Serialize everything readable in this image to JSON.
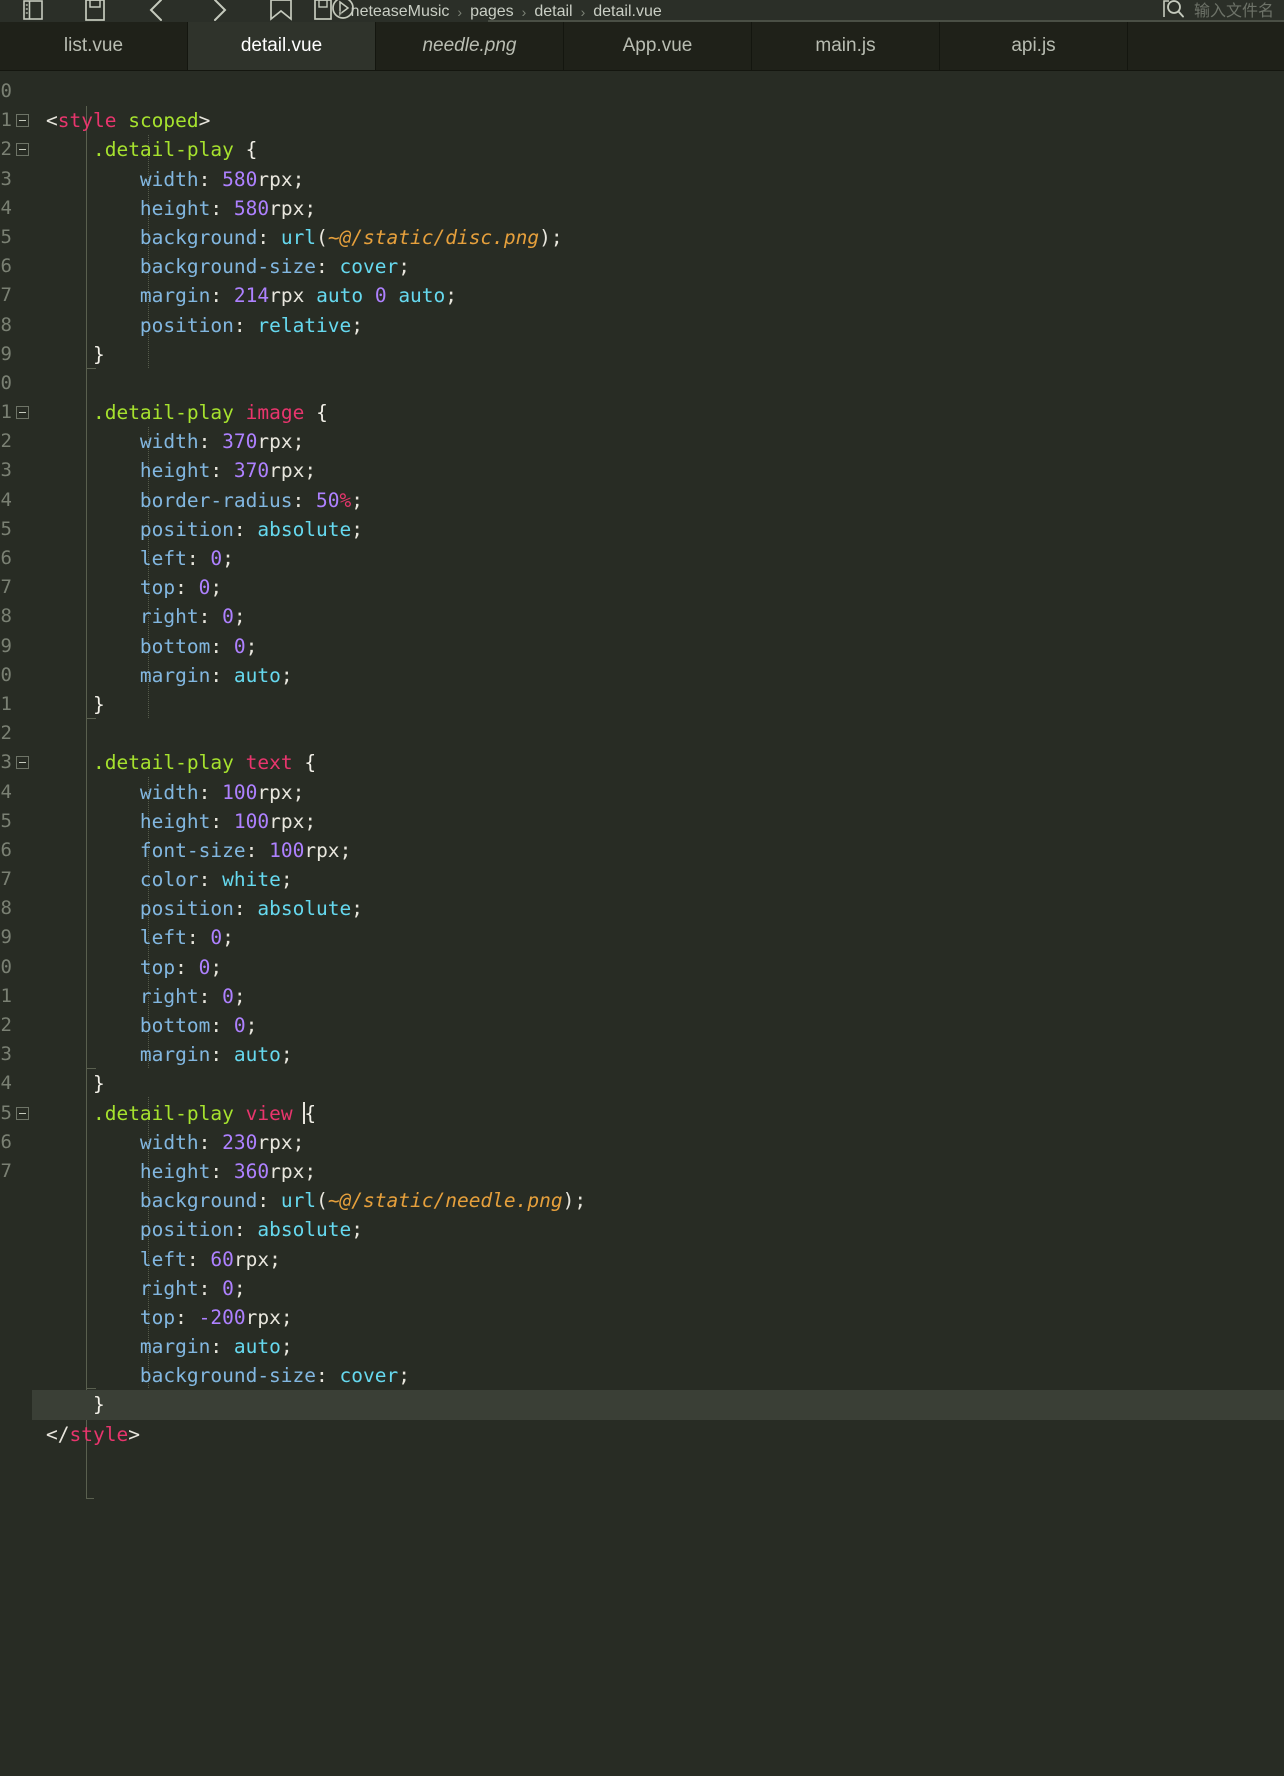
{
  "window": {
    "app": "HBuilderX",
    "theme_bg": "#282c24",
    "accent": "#a6e22e"
  },
  "toolbar": {
    "icons": [
      {
        "name": "sidebar-toggle-icon",
        "glyph": "sidebar"
      },
      {
        "name": "save-icon",
        "glyph": "floppy"
      },
      {
        "name": "back-icon",
        "glyph": "chevron-left"
      },
      {
        "name": "forward-icon",
        "glyph": "chevron-right"
      },
      {
        "name": "bookmark-icon",
        "glyph": "bookmark"
      },
      {
        "name": "run-icon",
        "glyph": "play-circle"
      }
    ],
    "breadcrumb": {
      "file_icon": "vue-file-icon",
      "items": [
        "neteaseMusic",
        "pages",
        "detail",
        "detail.vue"
      ],
      "separator": "›"
    },
    "search": {
      "icon": "search-icon",
      "placeholder": "输入文件名"
    }
  },
  "tabs": [
    {
      "label": "list.vue",
      "active": false,
      "italic": false
    },
    {
      "label": "detail.vue",
      "active": true,
      "italic": false
    },
    {
      "label": "needle.png",
      "active": false,
      "italic": true
    },
    {
      "label": "App.vue",
      "active": false,
      "italic": false
    },
    {
      "label": "main.js",
      "active": false,
      "italic": false
    },
    {
      "label": "api.js",
      "active": false,
      "italic": false
    }
  ],
  "editor": {
    "language": "vue",
    "current_line_index": 34,
    "cursor_line_index": 24,
    "line_numbers": [
      "0",
      "1",
      "2",
      "3",
      "4",
      "5",
      "6",
      "7",
      "8",
      "9",
      "0",
      "1",
      "2",
      "3",
      "4",
      "5",
      "6",
      "7",
      "8",
      "9",
      "0",
      "1",
      "2",
      "3",
      "4",
      "5",
      "6",
      "7",
      "8",
      "9",
      "0",
      "1",
      "2",
      "3",
      "4",
      "5",
      "6",
      "7"
    ],
    "fold_rows": [
      1,
      2,
      11,
      23,
      25
    ],
    "lines": [
      {
        "i": 0,
        "text": ""
      },
      {
        "i": 1,
        "text": "<style scoped>"
      },
      {
        "i": 2,
        "text": "    .detail-play {"
      },
      {
        "i": 3,
        "text": "        width: 580rpx;"
      },
      {
        "i": 4,
        "text": "        height: 580rpx;"
      },
      {
        "i": 5,
        "text": "        background: url(~@/static/disc.png);"
      },
      {
        "i": 6,
        "text": "        background-size: cover;"
      },
      {
        "i": 7,
        "text": "        margin: 214rpx auto 0 auto;"
      },
      {
        "i": 8,
        "text": "        position: relative;"
      },
      {
        "i": 9,
        "text": "    }"
      },
      {
        "i": 10,
        "text": ""
      },
      {
        "i": 11,
        "text": "    .detail-play image {"
      },
      {
        "i": 12,
        "text": "        width: 370rpx;"
      },
      {
        "i": 13,
        "text": "        height: 370rpx;"
      },
      {
        "i": 14,
        "text": "        border-radius: 50%;"
      },
      {
        "i": 15,
        "text": "        position: absolute;"
      },
      {
        "i": 16,
        "text": "        left: 0;"
      },
      {
        "i": 17,
        "text": "        top: 0;"
      },
      {
        "i": 18,
        "text": "        right: 0;"
      },
      {
        "i": 19,
        "text": "        bottom: 0;"
      },
      {
        "i": 20,
        "text": "        margin: auto;"
      },
      {
        "i": 21,
        "text": "    }"
      },
      {
        "i": 22,
        "text": ""
      },
      {
        "i": 23,
        "text": "    .detail-play text {"
      },
      {
        "i": 24,
        "text": "        width: 100rpx;"
      },
      {
        "i": 25,
        "text": "        height: 100rpx;"
      },
      {
        "i": 26,
        "text": "        font-size: 100rpx;"
      },
      {
        "i": 27,
        "text": "        color: white;"
      },
      {
        "i": 28,
        "text": "        position: absolute;"
      },
      {
        "i": 29,
        "text": "        left: 0;"
      },
      {
        "i": 30,
        "text": "        top: 0;"
      },
      {
        "i": 31,
        "text": "        right: 0;"
      },
      {
        "i": 32,
        "text": "        bottom: 0;"
      },
      {
        "i": 33,
        "text": "        margin: auto;"
      },
      {
        "i": 34,
        "text": "    }"
      },
      {
        "i": 35,
        "text": "    .detail-play view {"
      },
      {
        "i": 36,
        "text": "        width: 230rpx;"
      },
      {
        "i": 37,
        "text": "        height: 360rpx;"
      },
      {
        "i": 38,
        "text": "        background: url(~@/static/needle.png);"
      },
      {
        "i": 39,
        "text": "        position: absolute;"
      },
      {
        "i": 40,
        "text": "        left: 60rpx;"
      },
      {
        "i": 41,
        "text": "        right: 0;"
      },
      {
        "i": 42,
        "text": "        top: -200rpx;"
      },
      {
        "i": 43,
        "text": "        margin: auto;"
      },
      {
        "i": 44,
        "text": "        background-size: cover;"
      },
      {
        "i": 45,
        "text": "    }"
      },
      {
        "i": 46,
        "text": "</style>"
      },
      {
        "i": 47,
        "text": ""
      }
    ],
    "code_tokens": {
      "l1": [
        [
          "s-punct",
          "<"
        ],
        [
          "s-tag",
          "style"
        ],
        [
          "s-punct",
          " "
        ],
        [
          "s-attr",
          "scoped"
        ],
        [
          "s-punct",
          ">"
        ]
      ],
      "l2": [
        [
          "s-sel",
          "    .detail-play"
        ],
        [
          "s-punct",
          " "
        ],
        [
          "s-brace",
          "{"
        ]
      ],
      "l3": [
        [
          "s-prop",
          "        width"
        ],
        [
          "s-punct",
          ": "
        ],
        [
          "s-num",
          "580"
        ],
        [
          "s-unit",
          "rpx"
        ],
        [
          "s-punct",
          ";"
        ]
      ],
      "l4": [
        [
          "s-prop",
          "        height"
        ],
        [
          "s-punct",
          ": "
        ],
        [
          "s-num",
          "580"
        ],
        [
          "s-unit",
          "rpx"
        ],
        [
          "s-punct",
          ";"
        ]
      ],
      "l5": [
        [
          "s-prop",
          "        background"
        ],
        [
          "s-punct",
          ": "
        ],
        [
          "s-func",
          "url"
        ],
        [
          "s-punct",
          "("
        ],
        [
          "s-str",
          "~@/static/disc.png"
        ],
        [
          "s-punct",
          ");"
        ]
      ],
      "l6": [
        [
          "s-prop",
          "        background-size"
        ],
        [
          "s-punct",
          ": "
        ],
        [
          "s-value",
          "cover"
        ],
        [
          "s-punct",
          ";"
        ]
      ],
      "l7": [
        [
          "s-prop",
          "        margin"
        ],
        [
          "s-punct",
          ": "
        ],
        [
          "s-num",
          "214"
        ],
        [
          "s-unit",
          "rpx "
        ],
        [
          "s-value",
          "auto"
        ],
        [
          "s-punct",
          " "
        ],
        [
          "s-num",
          "0"
        ],
        [
          "s-punct",
          " "
        ],
        [
          "s-value",
          "auto"
        ],
        [
          "s-punct",
          ";"
        ]
      ],
      "l8": [
        [
          "s-prop",
          "        position"
        ],
        [
          "s-punct",
          ": "
        ],
        [
          "s-value",
          "relative"
        ],
        [
          "s-punct",
          ";"
        ]
      ],
      "l9": [
        [
          "s-brace",
          "    }"
        ]
      ],
      "l11": [
        [
          "s-sel",
          "    .detail-play"
        ],
        [
          "s-punct",
          " "
        ],
        [
          "s-elem",
          "image"
        ],
        [
          "s-punct",
          " "
        ],
        [
          "s-brace",
          "{"
        ]
      ],
      "l14": [
        [
          "s-prop",
          "        border-radius"
        ],
        [
          "s-punct",
          ": "
        ],
        [
          "s-num",
          "50"
        ],
        [
          "s-pct",
          "%"
        ],
        [
          "s-punct",
          ";"
        ]
      ],
      "l23": [
        [
          "s-sel",
          "    .detail-play"
        ],
        [
          "s-punct",
          " "
        ],
        [
          "s-elem",
          "text"
        ],
        [
          "s-punct",
          " "
        ],
        [
          "s-brace",
          "{"
        ]
      ],
      "l27": [
        [
          "s-prop",
          "        color"
        ],
        [
          "s-punct",
          ": "
        ],
        [
          "s-white",
          "white"
        ],
        [
          "s-punct",
          ";"
        ]
      ],
      "l35": [
        [
          "s-sel",
          "    .detail-play"
        ],
        [
          "s-punct",
          " "
        ],
        [
          "s-elem",
          "view"
        ],
        [
          "s-punct",
          " "
        ],
        [
          "s-brace",
          "{"
        ]
      ],
      "l38": [
        [
          "s-prop",
          "        background"
        ],
        [
          "s-punct",
          ": "
        ],
        [
          "s-func",
          "url"
        ],
        [
          "s-punct",
          "("
        ],
        [
          "s-str",
          "~@/static/needle.png"
        ],
        [
          "s-punct",
          ");"
        ]
      ],
      "l42": [
        [
          "s-prop",
          "        top"
        ],
        [
          "s-punct",
          ": "
        ],
        [
          "s-num",
          "-200"
        ],
        [
          "s-unit",
          "rpx"
        ],
        [
          "s-punct",
          ";"
        ]
      ],
      "l46": [
        [
          "s-punct",
          "</"
        ],
        [
          "s-tag",
          "style"
        ],
        [
          "s-punct",
          ">"
        ]
      ]
    }
  }
}
